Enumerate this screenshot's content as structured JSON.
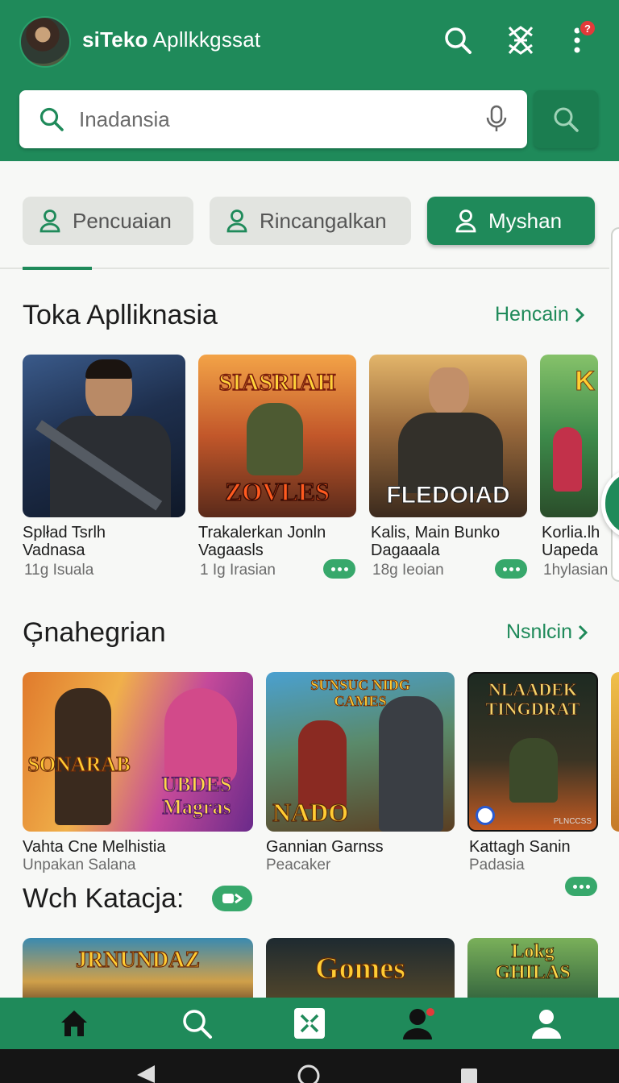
{
  "header": {
    "title_bold": "siTeko",
    "title_rest": " Apllkkgssat",
    "notification_count": "?"
  },
  "search": {
    "placeholder": "Inadansia"
  },
  "tabs": [
    {
      "label": "Pencuaian",
      "active": false
    },
    {
      "label": "Rincangalkan",
      "active": false
    },
    {
      "label": "Myshan",
      "active": true
    }
  ],
  "section1": {
    "title": "Toka Aplliknasia",
    "see_more": "Hencain",
    "cards": [
      {
        "title": "Splład Tsrlh\nVadnasa",
        "sub": "11g Isuala",
        "banner": "",
        "has_more": false
      },
      {
        "title": "Trakalerkan Jonln\nVagaasls",
        "sub": "1 Ig Irasian",
        "banner_top": "SIASRIAH",
        "banner_bottom": "ZOVLES",
        "has_more": true
      },
      {
        "title": "Kalis, Main Bunko\nDagaaala",
        "sub": "18g Ieoian",
        "banner_bottom": "FLEDOIAD",
        "has_more": true
      },
      {
        "title": "Korlia.lh\nUapeda",
        "sub": "1hylasian",
        "banner_top": "K",
        "has_more": false
      }
    ]
  },
  "section2": {
    "title": "Ģnahegrian",
    "see_more": "Nsnlcin",
    "cards": [
      {
        "title": "Vahta Cne Melhistia",
        "sub": "Unpakan Salana",
        "banner_left": "SONARAB",
        "banner_right": "UBDES\nMagras"
      },
      {
        "title": "Gannian Garnss",
        "sub": "Peacaker",
        "banner_top": "SUNSUC NIDG\nCAMES",
        "banner_bottom": "NADO"
      },
      {
        "title": "Kattagh Sanin",
        "sub": "Padasia",
        "banner_top": "NLAADEK\nTINGDRAT",
        "banner_bottom": "PLNCCSS",
        "has_more": true
      }
    ]
  },
  "section3": {
    "title": "Wch Katacja:",
    "cards": [
      {
        "banner": "JRNUNDAZ"
      },
      {
        "banner": "Gomes"
      },
      {
        "banner": "Lokg\nGHILAS"
      }
    ]
  },
  "colors": {
    "brand": "#1f8a5a",
    "brand_dark": "#1b7d50",
    "pill": "#37a86b"
  },
  "bottom_nav": [
    {
      "icon": "home-icon"
    },
    {
      "icon": "search-icon"
    },
    {
      "icon": "games-icon"
    },
    {
      "icon": "notification-person-icon"
    },
    {
      "icon": "profile-icon"
    }
  ]
}
